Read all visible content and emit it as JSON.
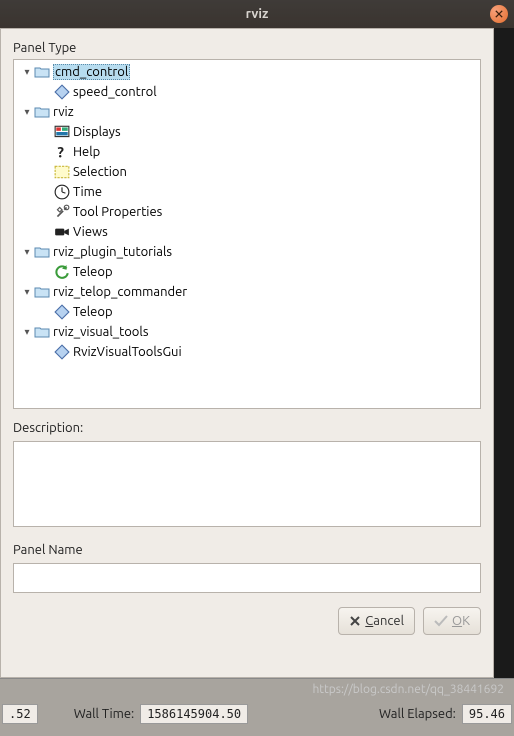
{
  "window": {
    "title": "rviz"
  },
  "panel_type_label": "Panel Type",
  "tree": {
    "items": [
      {
        "kind": "folder",
        "label": "cmd_control",
        "depth": 0,
        "expanded": true,
        "selected": true
      },
      {
        "kind": "diamond",
        "label": "speed_control",
        "depth": 1
      },
      {
        "kind": "folder",
        "label": "rviz",
        "depth": 0,
        "expanded": true
      },
      {
        "kind": "displays",
        "label": "Displays",
        "depth": 1
      },
      {
        "kind": "help",
        "label": "Help",
        "depth": 1
      },
      {
        "kind": "selection",
        "label": "Selection",
        "depth": 1
      },
      {
        "kind": "clock",
        "label": "Time",
        "depth": 1
      },
      {
        "kind": "tools",
        "label": "Tool Properties",
        "depth": 1
      },
      {
        "kind": "views",
        "label": "Views",
        "depth": 1
      },
      {
        "kind": "folder",
        "label": "rviz_plugin_tutorials",
        "depth": 0,
        "expanded": true
      },
      {
        "kind": "refresh",
        "label": "Teleop",
        "depth": 1
      },
      {
        "kind": "folder",
        "label": "rviz_telop_commander",
        "depth": 0,
        "expanded": true
      },
      {
        "kind": "diamond",
        "label": "Teleop",
        "depth": 1
      },
      {
        "kind": "folder",
        "label": "rviz_visual_tools",
        "depth": 0,
        "expanded": true
      },
      {
        "kind": "diamond",
        "label": "RvizVisualToolsGui",
        "depth": 1
      }
    ]
  },
  "description_label": "Description:",
  "panel_name_label": "Panel Name",
  "buttons": {
    "cancel": "Cancel",
    "ok": "OK"
  },
  "status": {
    "left_value": ".52",
    "wall_time_label": "Wall Time:",
    "wall_time_value": "1586145904.50",
    "wall_elapsed_label": "Wall Elapsed:",
    "wall_elapsed_value": "95.46"
  },
  "watermark": "https://blog.csdn.net/qq_38441692"
}
